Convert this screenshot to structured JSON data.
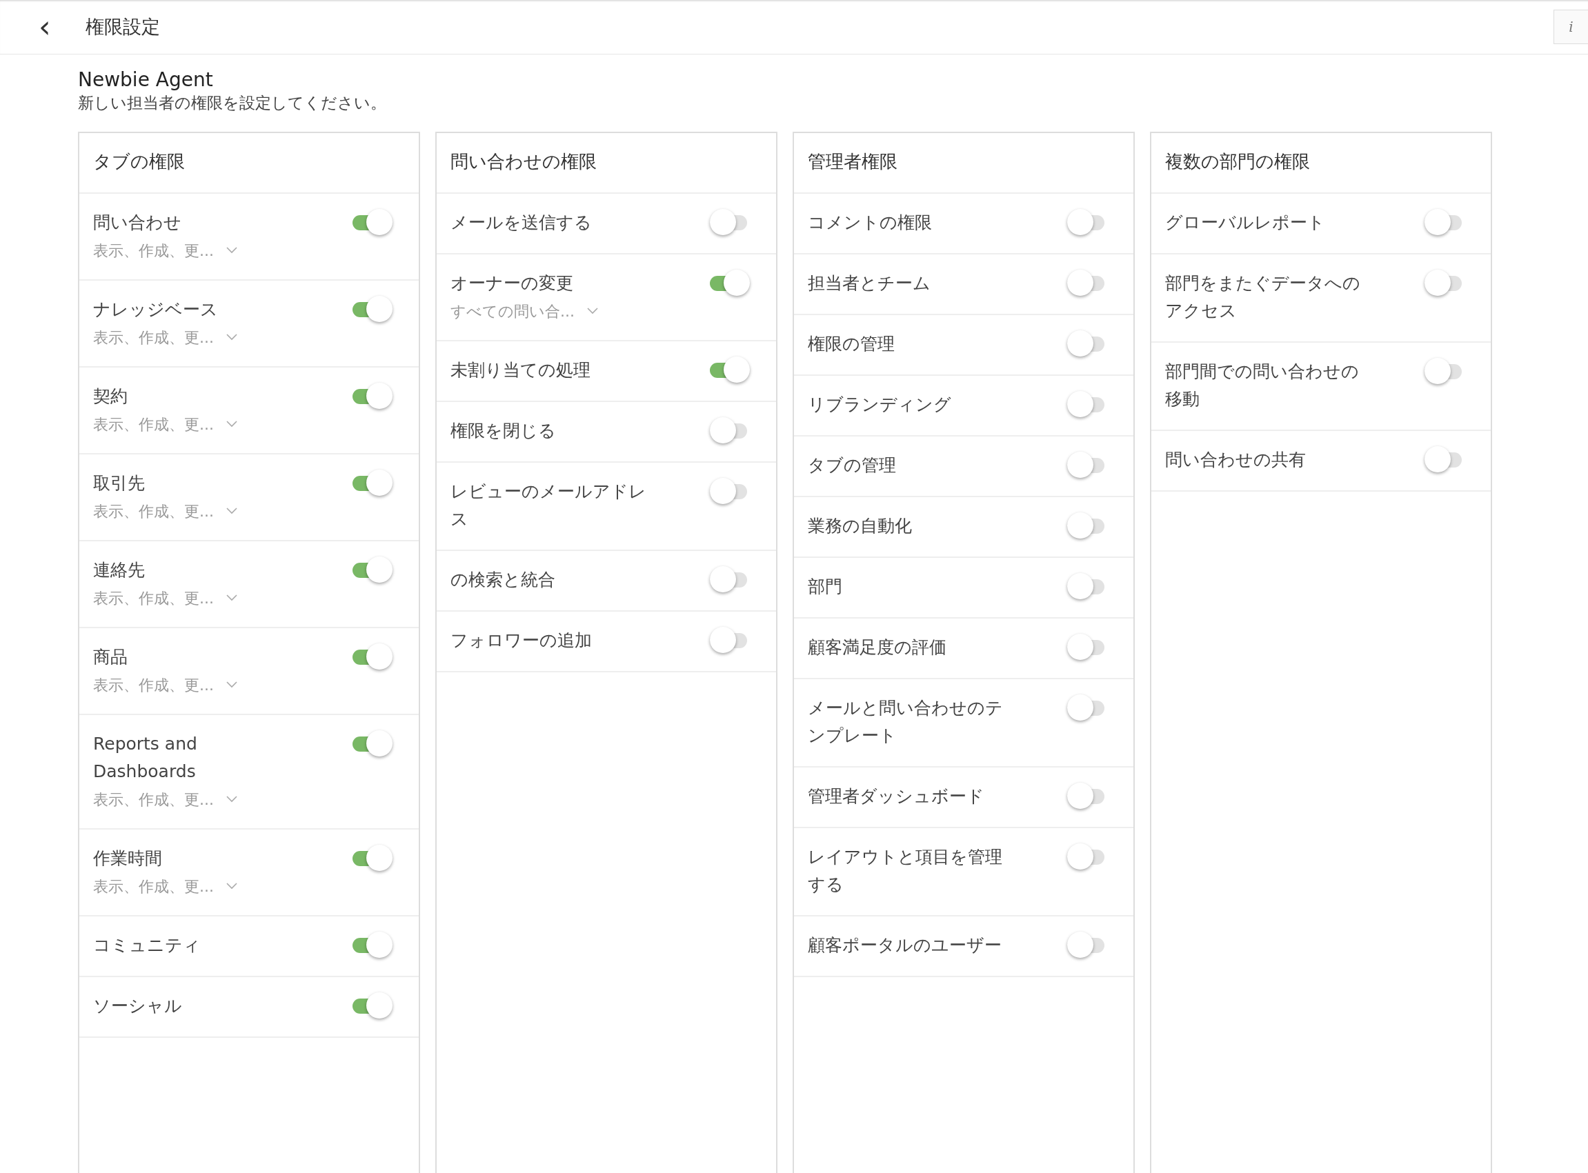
{
  "header": {
    "back": "‹",
    "title": "権限設定",
    "info": "i"
  },
  "profile": {
    "name": "Newbie Agent",
    "description": "新しい担当者の権限を設定してください。"
  },
  "panels": [
    {
      "title": "タブの権限",
      "items": [
        {
          "label": "問い合わせ",
          "on": true,
          "detail": "表示、作成、更..."
        },
        {
          "label": "ナレッジベース",
          "on": true,
          "detail": "表示、作成、更..."
        },
        {
          "label": "契約",
          "on": true,
          "detail": "表示、作成、更..."
        },
        {
          "label": "取引先",
          "on": true,
          "detail": "表示、作成、更..."
        },
        {
          "label": "連絡先",
          "on": true,
          "detail": "表示、作成、更..."
        },
        {
          "label": "商品",
          "on": true,
          "detail": "表示、作成、更..."
        },
        {
          "label": "Reports and Dashboards",
          "on": true,
          "detail": "表示、作成、更..."
        },
        {
          "label": "作業時間",
          "on": true,
          "detail": "表示、作成、更..."
        },
        {
          "label": "コミュニティ",
          "on": true
        },
        {
          "label": "ソーシャル",
          "on": true
        }
      ]
    },
    {
      "title": "問い合わせの権限",
      "items": [
        {
          "label": "メールを送信する",
          "on": false
        },
        {
          "label": "オーナーの変更",
          "on": true,
          "detail": "すべての問い合..."
        },
        {
          "label": "未割り当ての処理",
          "on": true
        },
        {
          "label": "権限を閉じる",
          "on": false
        },
        {
          "label": "レビューのメールアドレス",
          "on": false
        },
        {
          "label": "の検索と統合",
          "on": false
        },
        {
          "label": "フォロワーの追加",
          "on": false
        }
      ]
    },
    {
      "title": "管理者権限",
      "items": [
        {
          "label": "コメントの権限",
          "on": false
        },
        {
          "label": "担当者とチーム",
          "on": false
        },
        {
          "label": "権限の管理",
          "on": false
        },
        {
          "label": "リブランディング",
          "on": false
        },
        {
          "label": "タブの管理",
          "on": false
        },
        {
          "label": "業務の自動化",
          "on": false
        },
        {
          "label": "部門",
          "on": false
        },
        {
          "label": "顧客満足度の評価",
          "on": false
        },
        {
          "label": "メールと問い合わせのテンプレート",
          "on": false
        },
        {
          "label": "管理者ダッシュボード",
          "on": false
        },
        {
          "label": "レイアウトと項目を管理する",
          "on": false
        },
        {
          "label": "顧客ポータルのユーザー",
          "on": false
        }
      ]
    },
    {
      "title": "複数の部門の権限",
      "items": [
        {
          "label": "グローバルレポート",
          "on": false
        },
        {
          "label": "部門をまたぐデータへのアクセス",
          "on": false
        },
        {
          "label": "部門間での問い合わせの移動",
          "on": false
        },
        {
          "label": "問い合わせの共有",
          "on": false
        }
      ]
    }
  ]
}
